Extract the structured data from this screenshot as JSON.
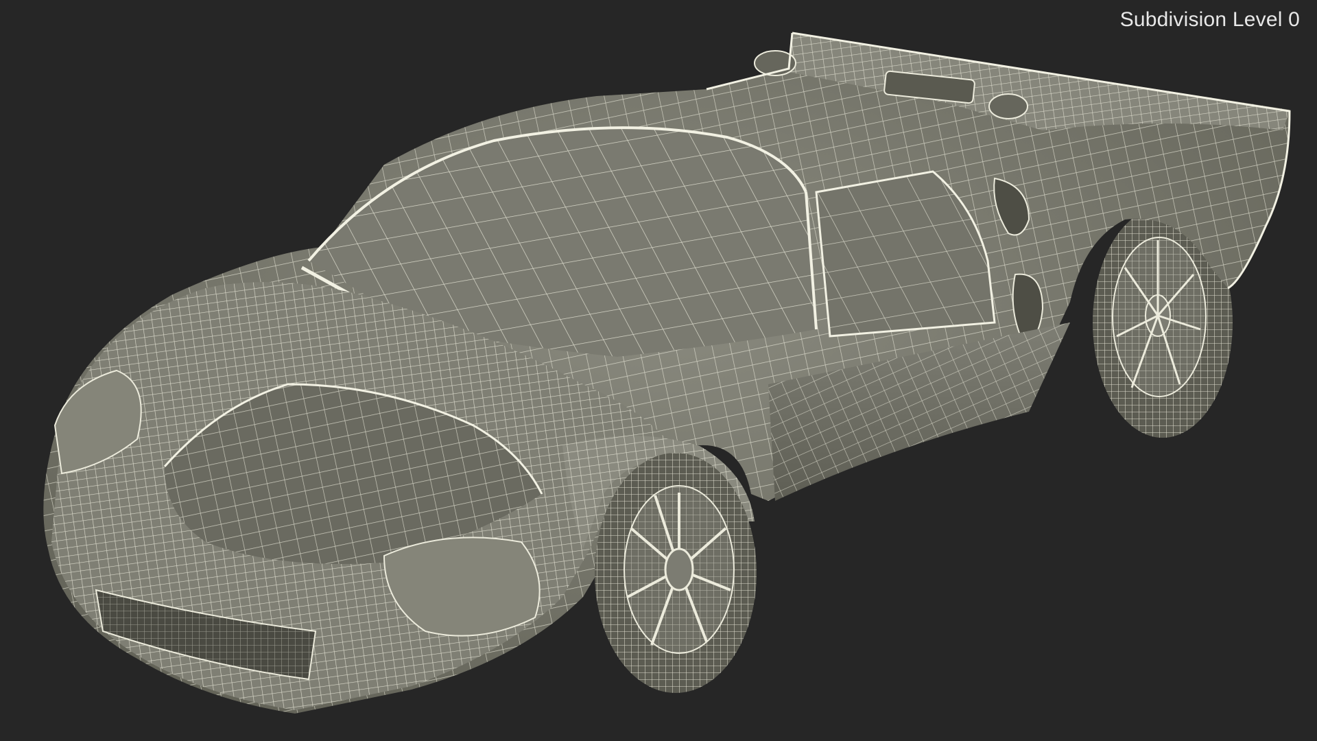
{
  "viewport": {
    "background_color": "#262626",
    "overlay_label": "Subdivision Level 0"
  },
  "model": {
    "subject": "wireframe sports car render",
    "surface_color": "#7c7c72",
    "wire_color": "#eeeedf",
    "shadow_color": "#55554c"
  }
}
